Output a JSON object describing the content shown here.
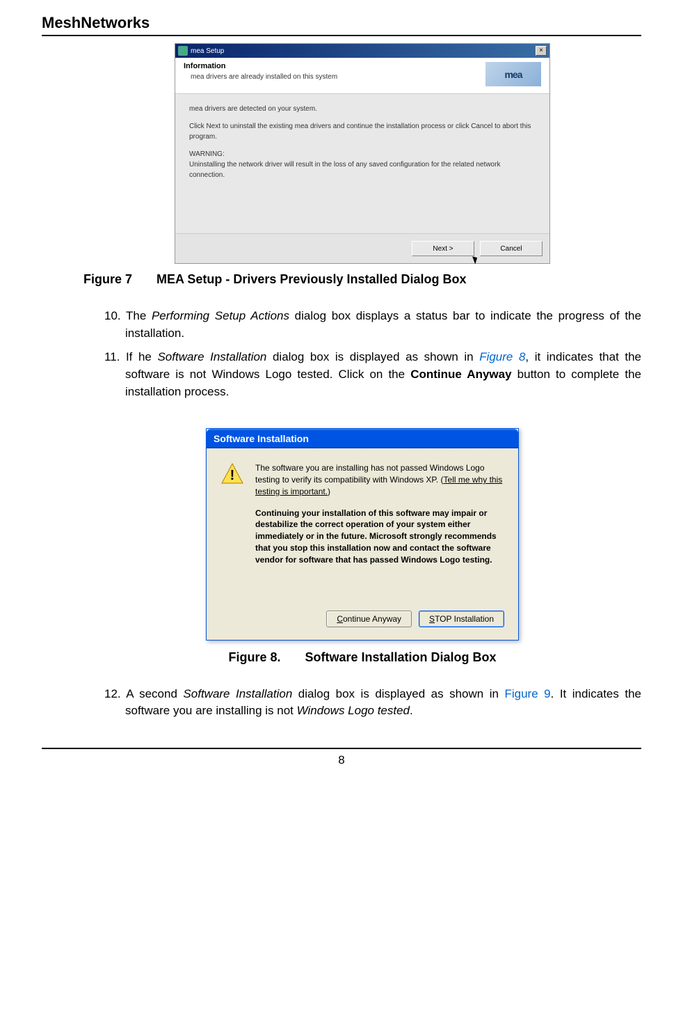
{
  "header": {
    "title": "MeshNetworks"
  },
  "dialog1": {
    "title": "mea Setup",
    "info_heading": "Information",
    "info_text": "mea drivers are already installed on this system",
    "logo_text": "mea",
    "body_line1": "mea drivers are detected on your system.",
    "body_line2": "Click Next to uninstall the existing mea drivers and continue the installation process or click Cancel to abort this program.",
    "body_warning_label": "WARNING:",
    "body_warning_text": "Uninstalling the network driver will result in the loss of any saved configuration for the related network connection.",
    "next_btn": "Next >",
    "cancel_btn": "Cancel"
  },
  "figure7": {
    "label": "Figure 7",
    "text": "MEA Setup - Drivers Previously Installed Dialog Box"
  },
  "step10": {
    "num": "10. ",
    "pre": "The ",
    "italic": "Performing Setup Actions",
    "post": " dialog box displays a status bar to indicate the progress of the installation."
  },
  "step11": {
    "num": "11. ",
    "pre": "If he ",
    "italic1": "Software Installation",
    "mid1": " dialog box is displayed as shown in ",
    "link": "Figure 8",
    "mid2": ", it indicates that the software is not Windows Logo tested.  Click on the ",
    "bold": "Continue Anyway",
    "post": " button to complete the installation process."
  },
  "dialog2": {
    "title": "Software Installation",
    "para1_pre": "The software you are installing has not passed Windows Logo testing to verify its compatibility with Windows XP. (",
    "para1_link": "Tell me why this testing is important.",
    "para1_post": ")",
    "para2": "Continuing your installation of this software may impair or destabilize the correct operation of your system either immediately or in the future. Microsoft strongly recommends that you stop this installation now and contact the software vendor for software that has passed Windows Logo testing.",
    "continue_pre": "C",
    "continue_post": "ontinue Anyway",
    "stop_pre": "S",
    "stop_post": "TOP Installation"
  },
  "figure8": {
    "label": "Figure 8.",
    "text": "Software Installation Dialog Box"
  },
  "step12": {
    "num": "12. ",
    "pre": "A second ",
    "italic1": "Software Installation",
    "mid1": " dialog box is displayed as shown in ",
    "link": "Figure 9",
    "mid2": ".  It indicates the software you are installing is not ",
    "italic2": "Windows Logo tested",
    "post": "."
  },
  "footer": {
    "page_number": "8"
  }
}
